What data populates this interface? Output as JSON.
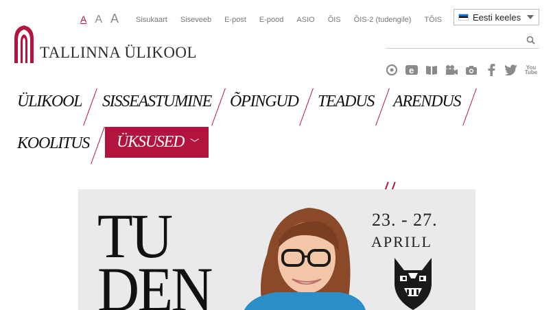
{
  "brand": {
    "name": "TALLINNA ÜLIKOOL",
    "accent": "#b3143d"
  },
  "font_sizes": [
    "A",
    "A",
    "A"
  ],
  "top_links": [
    "Sisukaart",
    "Siseveeb",
    "E-post",
    "E-pood",
    "ASIO",
    "ÕIS",
    "ÕIS-2 (tudengile)",
    "TÕIS"
  ],
  "language": {
    "selected": "Eesti keeles",
    "flag_colors": [
      "#0072ce",
      "#000000",
      "#ffffff"
    ]
  },
  "search": {
    "placeholder": ""
  },
  "social_icons": [
    "refresh-icon",
    "e-icon",
    "book-icon",
    "video-camera-icon",
    "camera-icon",
    "facebook-icon",
    "twitter-icon",
    "youtube-icon"
  ],
  "youtube": {
    "line1": "You",
    "line2": "Tube"
  },
  "nav": {
    "items": [
      "ÜLIKOOL",
      "SISSEASTUMINE",
      "ÕPINGUD",
      "TEADUS",
      "ARENDUS",
      "KOOLITUS"
    ],
    "active": "ÜKSUSED"
  },
  "banner": {
    "line1": "TU",
    "line2": "DEN",
    "date": "23. - 27.",
    "month": "APRILL"
  }
}
